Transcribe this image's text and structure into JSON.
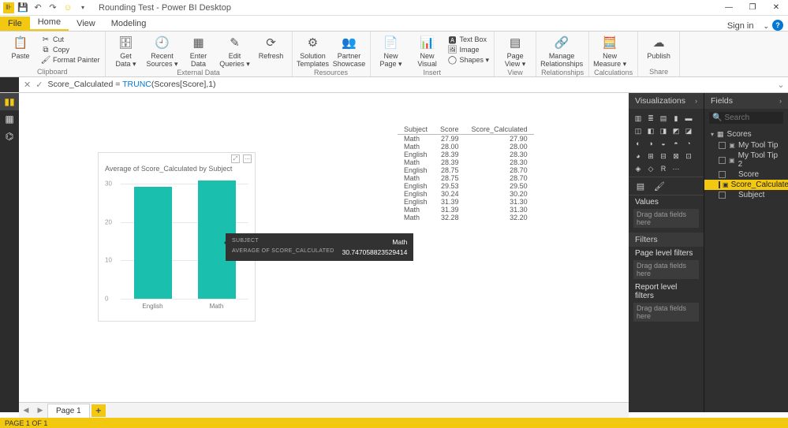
{
  "title": "Rounding Test - Power BI Desktop",
  "signin": "Sign in",
  "tabs": {
    "file": "File",
    "home": "Home",
    "view": "View",
    "modeling": "Modeling"
  },
  "ribbon": {
    "clipboard": {
      "label": "Clipboard",
      "paste": "Paste",
      "cut": "Cut",
      "copy": "Copy",
      "format_painter": "Format Painter"
    },
    "external": {
      "label": "External Data",
      "get_data": "Get\nData ▾",
      "recent": "Recent\nSources ▾",
      "enter": "Enter\nData",
      "edit_q": "Edit\nQueries ▾",
      "refresh": "Refresh"
    },
    "resources": {
      "label": "Resources",
      "solution": "Solution\nTemplates",
      "partner": "Partner\nShowcase"
    },
    "insert": {
      "label": "Insert",
      "new_page": "New\nPage ▾",
      "new_visual": "New\nVisual",
      "textbox": "Text Box",
      "image": "Image",
      "shapes": "Shapes ▾"
    },
    "view": {
      "label": "View",
      "page_view": "Page\nView ▾"
    },
    "relationships": {
      "label": "Relationships",
      "manage": "Manage\nRelationships"
    },
    "calculations": {
      "label": "Calculations",
      "new_measure": "New\nMeasure ▾"
    },
    "share": {
      "label": "Share",
      "publish": "Publish"
    }
  },
  "formula": {
    "name": "Score_Calculated",
    "op": " = ",
    "func": "TRUNC",
    "args": "(Scores[Score],1)"
  },
  "chart": {
    "title": "Average of Score_Calculated by Subject"
  },
  "chart_data": {
    "type": "bar",
    "title": "Average of Score_Calculated by Subject",
    "xlabel": "Subject",
    "ylabel": "Average of Score_Calculated",
    "categories": [
      "English",
      "Math"
    ],
    "values": [
      29.2,
      30.75
    ],
    "ylim": [
      0,
      32
    ],
    "yticks": [
      0,
      10,
      20,
      30
    ]
  },
  "tooltip": {
    "rows": [
      {
        "label": "SUBJECT",
        "value": "Math"
      },
      {
        "label": "AVERAGE OF SCORE_CALCULATED",
        "value": "30.747058823529414"
      }
    ]
  },
  "table": {
    "headers": [
      "Subject",
      "Score",
      "Score_Calculated"
    ],
    "rows": [
      [
        "Math",
        "27.99",
        "27.90"
      ],
      [
        "Math",
        "28.00",
        "28.00"
      ],
      [
        "English",
        "28.39",
        "28.30"
      ],
      [
        "Math",
        "28.39",
        "28.30"
      ],
      [
        "English",
        "28.75",
        "28.70"
      ],
      [
        "Math",
        "28.75",
        "28.70"
      ],
      [
        "English",
        "29.53",
        "29.50"
      ],
      [
        "English",
        "30.24",
        "30.20"
      ],
      [
        "English",
        "31.39",
        "31.30"
      ],
      [
        "Math",
        "31.39",
        "31.30"
      ],
      [
        "Math",
        "32.28",
        "32.20"
      ]
    ]
  },
  "viz_pane": {
    "title": "Visualizations",
    "values": "Values",
    "drop": "Drag data fields here",
    "filters": "Filters",
    "page_filters": "Page level filters",
    "report_filters": "Report level filters"
  },
  "fields_pane": {
    "title": "Fields",
    "search_placeholder": "Search",
    "table": "Scores",
    "fields": [
      {
        "name": "My Tool Tip",
        "icon": "fx",
        "selected": false
      },
      {
        "name": "My Tool Tip 2",
        "icon": "fx",
        "selected": false
      },
      {
        "name": "Score",
        "icon": "",
        "selected": false
      },
      {
        "name": "Score_Calculated",
        "icon": "fx",
        "selected": true
      },
      {
        "name": "Subject",
        "icon": "",
        "selected": false
      }
    ]
  },
  "pagetab": "Page 1",
  "statusbar": "PAGE 1 OF 1"
}
